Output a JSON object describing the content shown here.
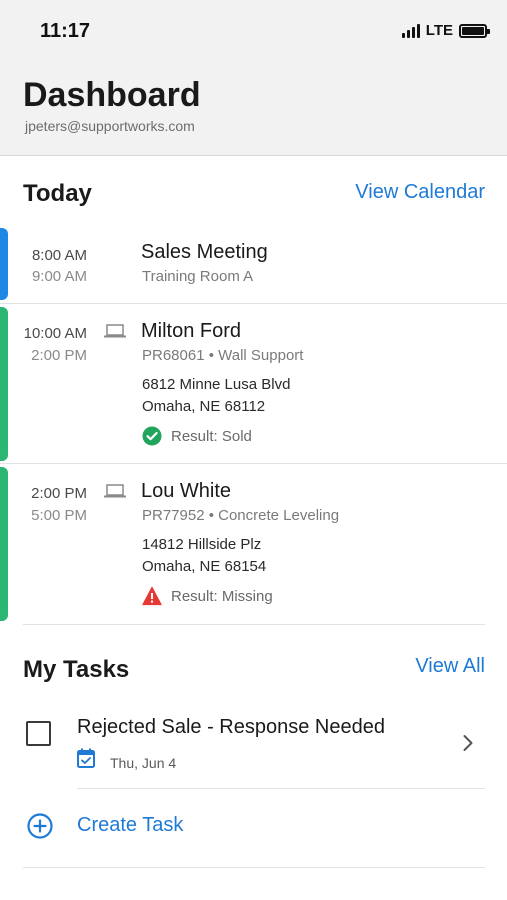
{
  "status_bar": {
    "time": "11:17",
    "network": "LTE",
    "icons": [
      "signal-icon",
      "battery-icon"
    ]
  },
  "header": {
    "title": "Dashboard",
    "email": "jpeters@supportworks.com"
  },
  "today": {
    "title": "Today",
    "link": "View Calendar",
    "appointments": [
      {
        "start": "8:00 AM",
        "end": "9:00 AM",
        "name": "Sales Meeting",
        "subtitle": "Training Room A",
        "color": "#1e88e5"
      },
      {
        "start": "10:00 AM",
        "end": "2:00 PM",
        "icon": "laptop-icon",
        "name": "Milton Ford",
        "subtitle": "PR68061 • Wall Support",
        "address1": "6812 Minne Lusa Blvd",
        "address2": "Omaha, NE 68112",
        "result": "Result: Sold",
        "result_icon": "check-circle-icon",
        "result_color": "#22a45d",
        "color": "#2bb673"
      },
      {
        "start": "2:00 PM",
        "end": "5:00 PM",
        "icon": "laptop-icon",
        "name": "Lou White",
        "subtitle": "PR77952 • Concrete Leveling",
        "address1": "14812 Hillside Plz",
        "address2": "Omaha, NE 68154",
        "result": "Result: Missing",
        "result_icon": "warning-icon",
        "result_color": "#e53935",
        "color": "#2bb673"
      }
    ]
  },
  "tasks": {
    "title": "My Tasks",
    "link": "View All",
    "items": [
      {
        "title": "Rejected Sale - Response Needed",
        "date": "Thu, Jun 4",
        "date_icon": "calendar-check-icon"
      }
    ],
    "create_label": "Create Task",
    "create_icon": "plus-circle-icon"
  },
  "colors": {
    "accent": "#1f7ad6",
    "header_bg": "#f2f2f2"
  }
}
